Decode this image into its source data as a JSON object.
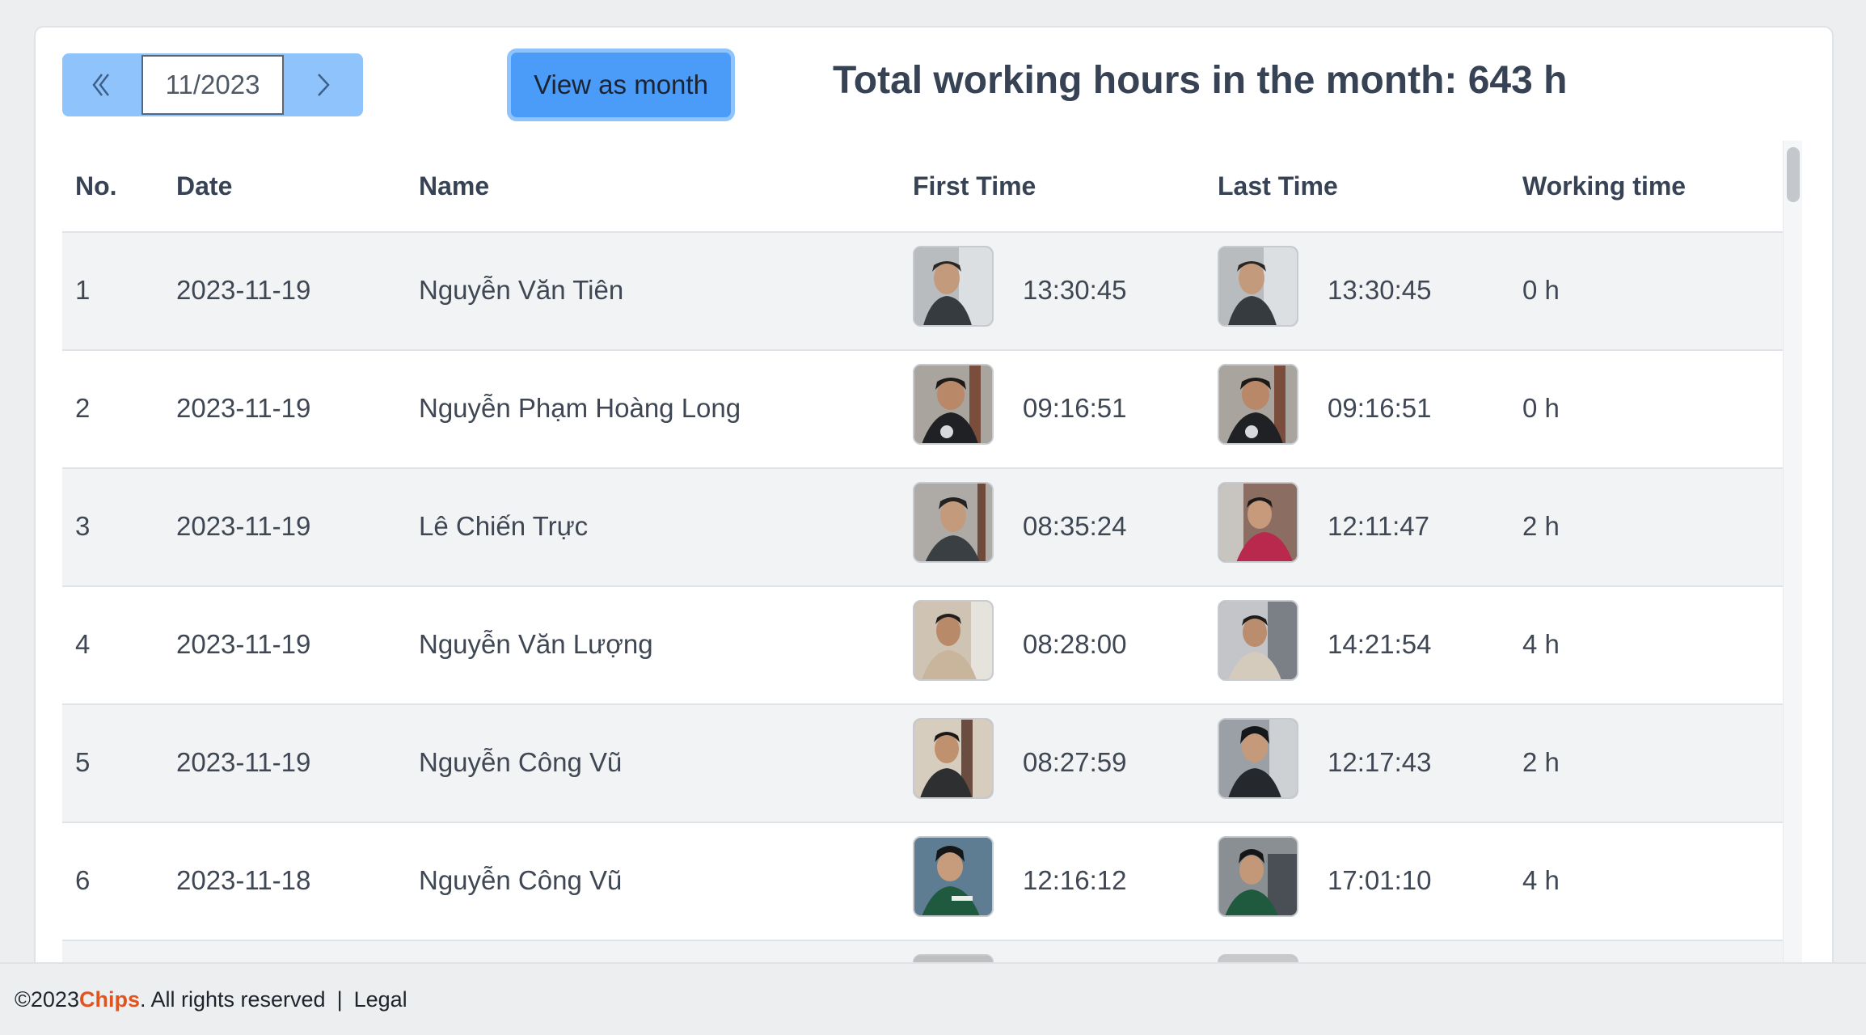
{
  "toolbar": {
    "month_value": "11/2023",
    "view_button_label": "View as month",
    "total_label": "Total working hours in the month: 643 h"
  },
  "table": {
    "columns": [
      "No.",
      "Date",
      "Name",
      "First Time",
      "Last Time",
      "Working time"
    ],
    "rows": [
      {
        "no": "1",
        "date": "2023-11-19",
        "name": "Nguyễn Văn Tiên",
        "first_time": "13:30:45",
        "last_time": "13:30:45",
        "working": "0 h"
      },
      {
        "no": "2",
        "date": "2023-11-19",
        "name": "Nguyễn Phạm Hoàng Long",
        "first_time": "09:16:51",
        "last_time": "09:16:51",
        "working": "0 h"
      },
      {
        "no": "3",
        "date": "2023-11-19",
        "name": "Lê Chiến Trực",
        "first_time": "08:35:24",
        "last_time": "12:11:47",
        "working": "2 h"
      },
      {
        "no": "4",
        "date": "2023-11-19",
        "name": "Nguyễn Văn Lượng",
        "first_time": "08:28:00",
        "last_time": "14:21:54",
        "working": "4 h"
      },
      {
        "no": "5",
        "date": "2023-11-19",
        "name": "Nguyễn Công Vũ",
        "first_time": "08:27:59",
        "last_time": "12:17:43",
        "working": "2 h"
      },
      {
        "no": "6",
        "date": "2023-11-18",
        "name": "Nguyễn Công Vũ",
        "first_time": "12:16:12",
        "last_time": "17:01:10",
        "working": "4 h"
      },
      {
        "no": "",
        "date": "",
        "name": "",
        "first_time": "",
        "last_time": "",
        "working": ""
      }
    ]
  },
  "footer": {
    "copyright": "©2023 ",
    "brand": "Chips",
    "rights": ". All rights reserved",
    "separator": "|",
    "legal": "Legal"
  },
  "colors": {
    "accent": "#4a9cf8",
    "accent_light": "#8ec3fb",
    "brand": "#e0541f"
  },
  "icons": {
    "prev": "chevron-left-icon",
    "next": "chevron-right-icon"
  }
}
